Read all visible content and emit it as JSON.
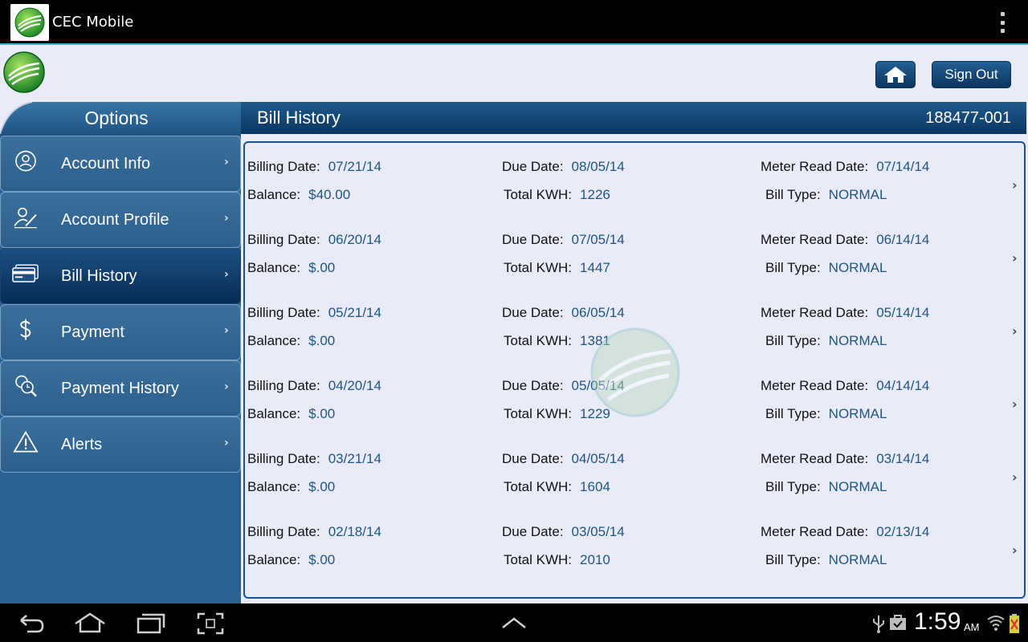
{
  "actionbar": {
    "title": "CEC Mobile"
  },
  "header": {
    "signout_label": "Sign Out"
  },
  "sidebar": {
    "title": "Options",
    "items": [
      {
        "label": "Account Info",
        "icon": "user-icon",
        "active": false
      },
      {
        "label": "Account Profile",
        "icon": "profile-edit-icon",
        "active": false
      },
      {
        "label": "Bill History",
        "icon": "credit-card-icon",
        "active": true
      },
      {
        "label": "Payment",
        "icon": "dollar-icon",
        "active": false
      },
      {
        "label": "Payment History",
        "icon": "search-history-icon",
        "active": false
      },
      {
        "label": "Alerts",
        "icon": "warning-icon",
        "active": false
      }
    ]
  },
  "main": {
    "title": "Bill History",
    "account_number": "188477-001",
    "labels": {
      "billing_date": "Billing Date:",
      "due_date": "Due Date:",
      "meter_read_date": "Meter Read Date:",
      "balance": "Balance:",
      "total_kwh": "Total KWH:",
      "bill_type": "Bill Type:"
    },
    "bills": [
      {
        "billing_date": "07/21/14",
        "due_date": "08/05/14",
        "meter_read_date": "07/14/14",
        "balance": "$40.00",
        "total_kwh": "1226",
        "bill_type": "NORMAL"
      },
      {
        "billing_date": "06/20/14",
        "due_date": "07/05/14",
        "meter_read_date": "06/14/14",
        "balance": "$.00",
        "total_kwh": "1447",
        "bill_type": "NORMAL"
      },
      {
        "billing_date": "05/21/14",
        "due_date": "06/05/14",
        "meter_read_date": "05/14/14",
        "balance": "$.00",
        "total_kwh": "1381",
        "bill_type": "NORMAL"
      },
      {
        "billing_date": "04/20/14",
        "due_date": "05/05/14",
        "meter_read_date": "04/14/14",
        "balance": "$.00",
        "total_kwh": "1229",
        "bill_type": "NORMAL"
      },
      {
        "billing_date": "03/21/14",
        "due_date": "04/05/14",
        "meter_read_date": "03/14/14",
        "balance": "$.00",
        "total_kwh": "1604",
        "bill_type": "NORMAL"
      },
      {
        "billing_date": "02/18/14",
        "due_date": "03/05/14",
        "meter_read_date": "02/13/14",
        "balance": "$.00",
        "total_kwh": "2010",
        "bill_type": "NORMAL"
      }
    ]
  },
  "system": {
    "time": "1:59",
    "ampm": "AM"
  },
  "colors": {
    "accent": "#34b5e5",
    "value_text": "#1f5582",
    "sidebar": "#2a6190"
  }
}
